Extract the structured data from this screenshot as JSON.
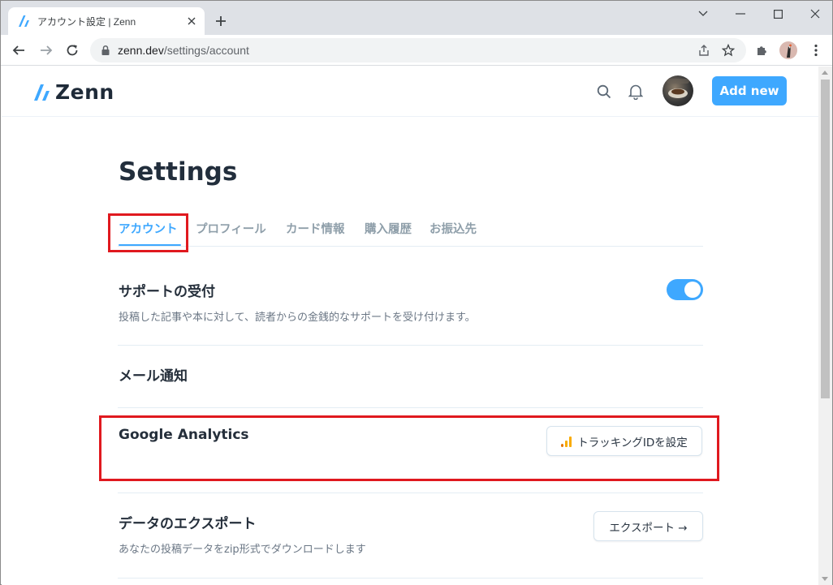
{
  "browser": {
    "tab": {
      "title": "アカウント設定 | Zenn"
    },
    "url": {
      "host": "zenn.dev",
      "path": "/settings/account"
    }
  },
  "header": {
    "logo_text": "Zenn",
    "add_new_label": "Add new"
  },
  "settings": {
    "title": "Settings",
    "tabs": [
      {
        "label": "アカウント",
        "active": true
      },
      {
        "label": "プロフィール",
        "active": false
      },
      {
        "label": "カード情報",
        "active": false
      },
      {
        "label": "購入履歴",
        "active": false
      },
      {
        "label": "お振込先",
        "active": false
      }
    ],
    "support": {
      "heading": "サポートの受付",
      "description": "投稿した記事や本に対して、読者からの金銭的なサポートを受け付けます。",
      "enabled": true
    },
    "mail": {
      "heading": "メール通知"
    },
    "analytics": {
      "heading": "Google Analytics",
      "button_label": "トラッキングIDを設定"
    },
    "export": {
      "heading": "データのエクスポート",
      "description": "あなたの投稿データをzip形式でダウンロードします",
      "button_label": "エクスポート →"
    }
  },
  "colors": {
    "accent": "#3ea8ff",
    "highlight": "#e0191f",
    "ga_orange": "#f9ab00",
    "ga_dark_orange": "#e37400"
  }
}
